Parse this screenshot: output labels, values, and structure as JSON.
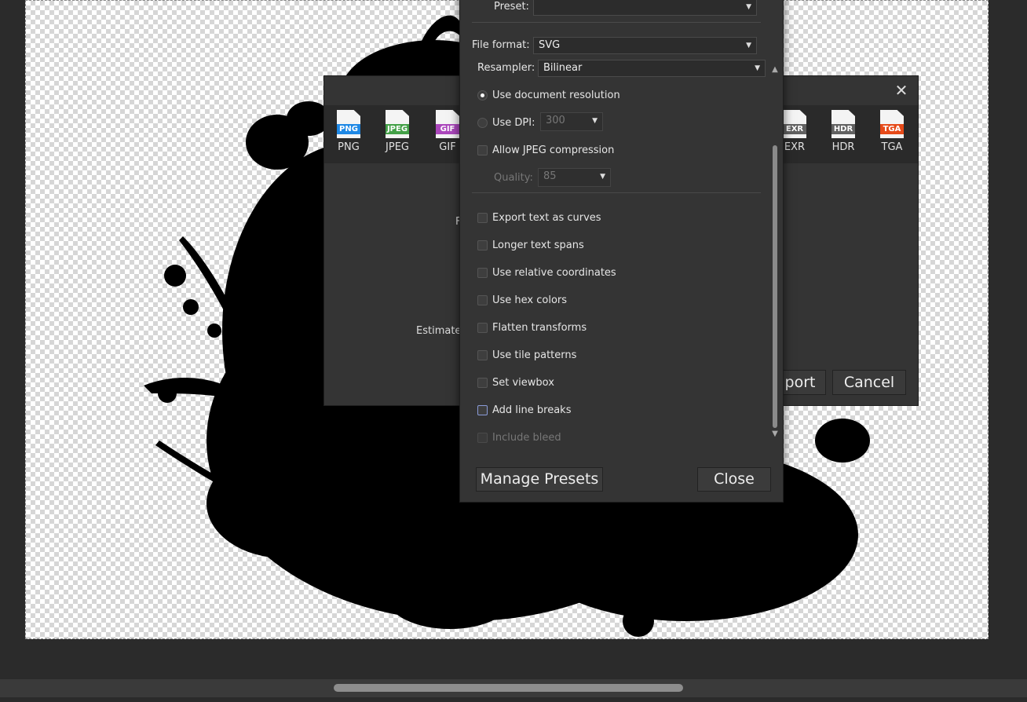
{
  "export_dialog": {
    "formats": [
      {
        "tag": "PNG",
        "label": "PNG",
        "color": "#1e88e5"
      },
      {
        "tag": "JPEG",
        "label": "JPEG",
        "color": "#43a047"
      },
      {
        "tag": "GIF",
        "label": "GIF",
        "color": "#ab47bc"
      },
      {
        "tag": "EXR",
        "label": "EXR",
        "color": "#616161"
      },
      {
        "tag": "HDR",
        "label": "HDR",
        "color": "#616161"
      },
      {
        "tag": "TGA",
        "label": "TGA",
        "color": "#e64a19"
      }
    ],
    "partial_label_1": "F",
    "partial_label_2": "Estimated",
    "export_button": "port",
    "cancel_button": "Cancel"
  },
  "more_panel": {
    "preset_label": "Preset:",
    "preset_value": "",
    "file_format_label": "File format:",
    "file_format_value": "SVG",
    "resampler_label": "Resampler:",
    "resampler_value": "Bilinear",
    "use_document_resolution": "Use document resolution",
    "use_dpi": "Use DPI:",
    "dpi_value": "300",
    "allow_jpeg_compression": "Allow JPEG compression",
    "quality_label": "Quality:",
    "quality_value": "85",
    "options": [
      {
        "label": "Export text as curves",
        "checked": false
      },
      {
        "label": "Longer text spans",
        "checked": false
      },
      {
        "label": "Use relative coordinates",
        "checked": false
      },
      {
        "label": "Use hex colors",
        "checked": false
      },
      {
        "label": "Flatten transforms",
        "checked": false
      },
      {
        "label": "Use tile patterns",
        "checked": false
      },
      {
        "label": "Set viewbox",
        "checked": false
      },
      {
        "label": "Add line breaks",
        "checked": false
      },
      {
        "label": "Include bleed",
        "checked": false
      }
    ],
    "manage_presets_button": "Manage Presets",
    "close_button": "Close"
  }
}
